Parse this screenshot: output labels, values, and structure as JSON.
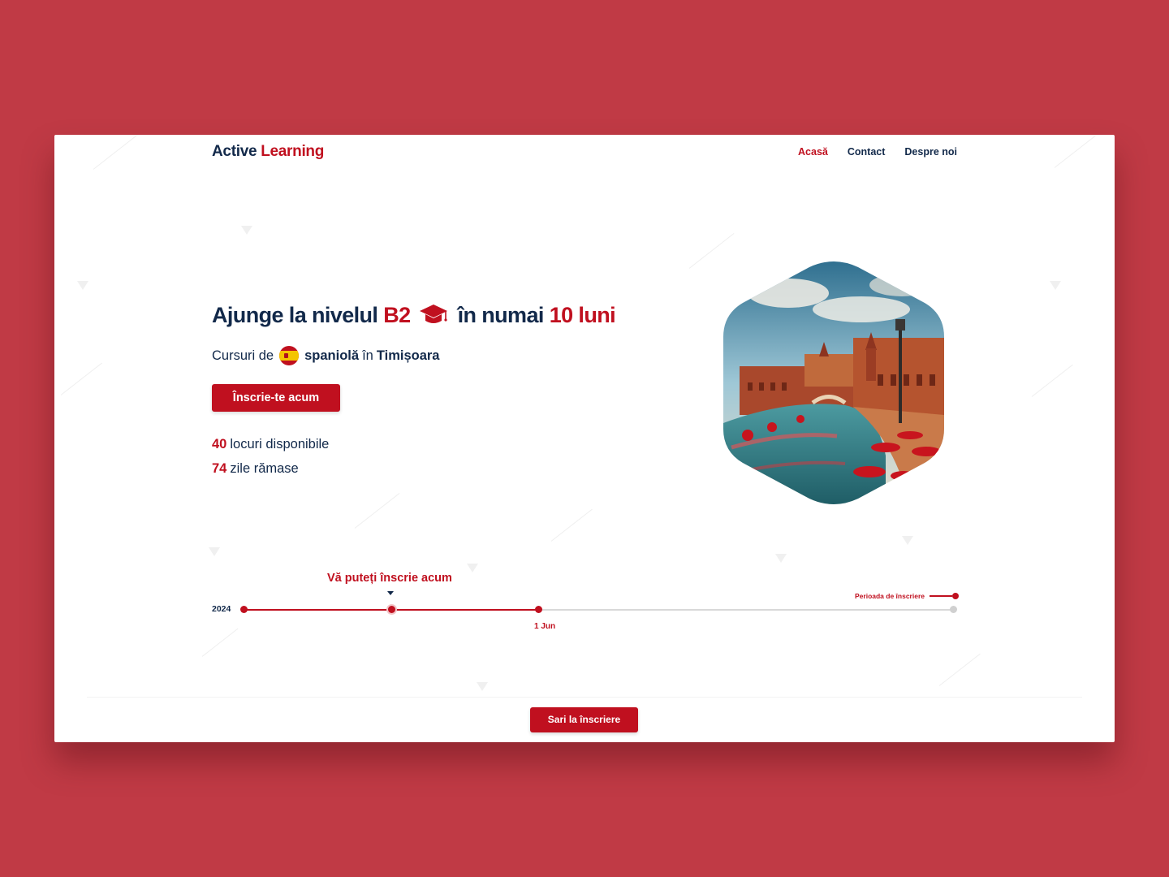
{
  "nav": {
    "logo_primary": "Active",
    "logo_accent": "Learning",
    "links": [
      {
        "label": "Acasă",
        "active": true
      },
      {
        "label": "Contact",
        "active": false
      },
      {
        "label": "Despre noi",
        "active": false
      }
    ]
  },
  "hero": {
    "headline_pre": "Ajunge la nivelul",
    "headline_level": "B2",
    "headline_mid": "în numai",
    "headline_duration": "10 luni",
    "headline_icon": "graduation-cap-icon",
    "sub_pre": "Cursuri de",
    "sub_flag": "spain-flag-icon",
    "sub_language": "spaniolă",
    "sub_in": "în",
    "sub_city": "Timișoara",
    "cta_label": "Înscrie-te acum",
    "stats": [
      {
        "value": "40",
        "label": "locuri disponibile"
      },
      {
        "value": "74",
        "label": "zile rămase"
      }
    ],
    "image": "plaza-de-espana-seville-hexagon-photo"
  },
  "timeline": {
    "year": "2024",
    "current_label": "Vă puteți înscrie acum",
    "date_label": "1 Jun",
    "legend_label": "Perioada de înscriere",
    "progress_fraction": 0.416
  },
  "footer": {
    "skip_label": "Sari la înscriere"
  },
  "colors": {
    "background": "#c03a45",
    "accent": "#c0101f",
    "text": "#12294a",
    "surface": "#ffffff"
  }
}
